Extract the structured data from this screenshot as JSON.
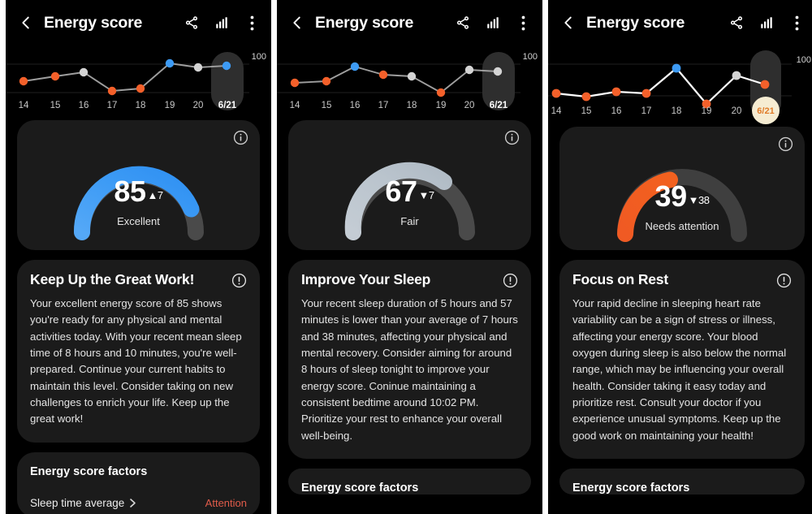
{
  "colors": {
    "accent_blue": "#3d9bf5",
    "accent_blue_light": "#54a8f7",
    "accent_orange": "#f05a23",
    "accent_gray": "#b9c3cc",
    "track_gray": "#4a4a4a",
    "attention_red": "#e05b4a",
    "card_bg": "#1b1b1b",
    "screen_bg": "#000000",
    "point_orange": "#f4602a",
    "point_blue": "#3d9bf5",
    "point_gray": "#d4d4d4",
    "highlight_pill": "#2e2e2e",
    "highlight_pill_orange": "#f6ecd2"
  },
  "panels": [
    {
      "header": {
        "back_icon": "chevron-left-icon",
        "title": "Energy score",
        "icons": [
          "share-icon",
          "bar-chart-icon",
          "overflow-menu-icon"
        ]
      },
      "chart_data": {
        "type": "line",
        "title": "Energy score trend",
        "categories": [
          "14",
          "15",
          "16",
          "17",
          "18",
          "19",
          "20",
          "6/21"
        ],
        "values": [
          62,
          66,
          72,
          48,
          50,
          80,
          76,
          78
        ],
        "point_colors": [
          "orange",
          "orange",
          "gray",
          "orange",
          "orange",
          "blue",
          "gray",
          "blue"
        ],
        "selected_index": 7,
        "selected_label": "6/21",
        "selected_highlight": "gray",
        "axis_max_label": "100",
        "ylim": [
          0,
          100
        ],
        "grid": true,
        "legend": "none"
      },
      "gauge": {
        "value": "85",
        "delta_arrow": "▲",
        "delta": "7",
        "delta_direction": "up",
        "label": "Excellent",
        "color_scheme": "blue",
        "fill_fraction": 0.86,
        "info_icon": "info-icon"
      },
      "advice": {
        "title": "Keep Up the Great Work!",
        "icon": "alert-circle-icon",
        "body": "Your excellent energy score of 85 shows you're ready for any physical and mental activities today. With your recent mean sleep time of 8 hours and 10 minutes, you're well-prepared. Continue your current habits to maintain this level. Consider taking on new challenges to enrich your life. Keep up the great work!"
      },
      "factors": {
        "title": "Energy score factors",
        "rows": [
          {
            "label": "Sleep time average",
            "chevron": "chevron-right-icon",
            "status": "Attention"
          }
        ]
      }
    },
    {
      "header": {
        "back_icon": "chevron-left-icon",
        "title": "Energy score",
        "icons": [
          "share-icon",
          "bar-chart-icon",
          "overflow-menu-icon"
        ]
      },
      "chart_data": {
        "type": "line",
        "title": "Energy score trend",
        "categories": [
          "14",
          "15",
          "16",
          "17",
          "18",
          "19",
          "20",
          "6/21"
        ],
        "values": [
          60,
          62,
          76,
          70,
          68,
          50,
          73,
          70
        ],
        "point_colors": [
          "orange",
          "orange",
          "blue",
          "orange",
          "gray",
          "orange",
          "gray",
          "gray"
        ],
        "selected_index": 7,
        "selected_label": "6/21",
        "selected_highlight": "gray",
        "axis_max_label": "100",
        "ylim": [
          0,
          100
        ],
        "grid": true,
        "legend": "none"
      },
      "gauge": {
        "value": "67",
        "delta_arrow": "▼",
        "delta": "7",
        "delta_direction": "down",
        "label": "Fair",
        "color_scheme": "gray",
        "fill_fraction": 0.68,
        "info_icon": "info-icon"
      },
      "advice": {
        "title": "Improve Your Sleep",
        "icon": "alert-circle-icon",
        "body": "Your recent sleep duration of 5 hours and 57 minutes is lower than your average of 7 hours and 38 minutes, affecting your physical and mental recovery. Consider aiming for around 8 hours of sleep tonight to improve your energy score. Coninue maintaining a consistent bedtime around 10:02 PM. Prioritize your rest to enhance your overall well-being."
      },
      "factors": {
        "title": "Energy score factors",
        "rows": []
      }
    },
    {
      "header": {
        "back_icon": "chevron-left-icon",
        "title": "Energy score",
        "icons": [
          "share-icon",
          "bar-chart-icon",
          "overflow-menu-icon"
        ]
      },
      "chart_data": {
        "type": "line",
        "title": "Energy score trend",
        "categories": [
          "14",
          "15",
          "16",
          "17",
          "18",
          "19",
          "20",
          "6/21"
        ],
        "values": [
          48,
          44,
          50,
          48,
          82,
          36,
          72,
          56
        ],
        "point_colors": [
          "orange",
          "orange",
          "orange",
          "orange",
          "blue",
          "orange",
          "gray",
          "orange"
        ],
        "selected_index": 7,
        "selected_label": "6/21",
        "selected_highlight": "orange",
        "axis_max_label": "100",
        "ylim": [
          0,
          100
        ],
        "grid": true,
        "legend": "none"
      },
      "gauge": {
        "value": "39",
        "delta_arrow": "▼",
        "delta": "38",
        "delta_direction": "down",
        "label": "Needs attention",
        "color_scheme": "orange",
        "fill_fraction": 0.4,
        "info_icon": "info-icon"
      },
      "advice": {
        "title": "Focus on Rest",
        "icon": "alert-circle-icon",
        "body": "Your rapid decline in sleeping heart rate variability can be a sign of stress or illness, affecting your energy score. Your blood oxygen during sleep is also below the normal range, which may be influencing your overall health. Consider taking it easy today and prioritize rest. Consult your doctor if you experience unusual symptoms. Keep up the good work on maintaining your health!"
      },
      "factors": {
        "title": "Energy score factors",
        "rows": []
      }
    }
  ]
}
